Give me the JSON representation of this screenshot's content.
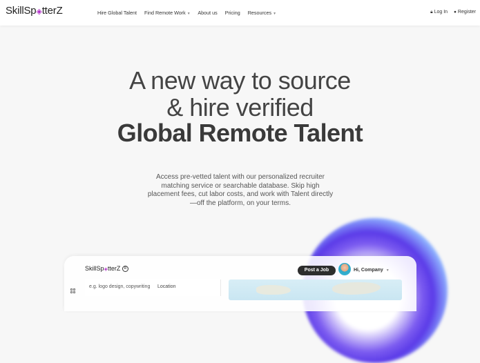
{
  "header": {
    "logo": {
      "pre": "SkillSp",
      "post": "tterZ"
    },
    "nav": [
      {
        "label": "Hire Global Talent",
        "has_caret": false
      },
      {
        "label": "Find Remote Work",
        "has_caret": true
      },
      {
        "label": "About us",
        "has_caret": false
      },
      {
        "label": "Pricing",
        "has_caret": false
      },
      {
        "label": "Resources",
        "has_caret": true
      }
    ],
    "login_label": "Log In",
    "register_label": "Register"
  },
  "hero": {
    "line1": "A new way to source",
    "line2": "& hire verified",
    "line3": "Global Remote Talent",
    "description": "Access pre-vetted talent with our personalized recruiter matching service or searchable database. Skip high placement fees, cut labor costs, and work with Talent directly—off the platform, on your terms."
  },
  "preview": {
    "logo": {
      "pre": "SkillSp",
      "post": "tterZ"
    },
    "post_job_label": "Post a Job",
    "company_label": "Hi, Company",
    "search_placeholder": "e.g. logo design, copywriting",
    "location_label": "Location"
  },
  "colors": {
    "accent": "#b02bc8",
    "blob_purple": "#5b3be8",
    "dark_button": "#2d2d2d"
  }
}
